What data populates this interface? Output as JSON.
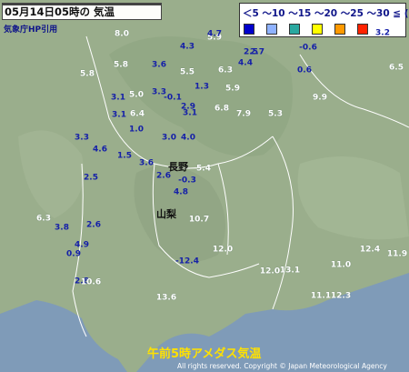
{
  "header": {
    "title": "05月14日05時の 気温",
    "credit": "気象庁HP引用"
  },
  "legend": {
    "scale_text": "＜5 ～10 ～15 ～20 ～25 ～30 ≦ (℃)",
    "colors": [
      "#0000cc",
      "#8fb2ff",
      "#2aa8a0",
      "#ffff00",
      "#ff9900",
      "#ff2200"
    ]
  },
  "cities": {
    "nagano": "長野",
    "yamanashi": "山梨"
  },
  "footer": {
    "caption": "午前5時アメダス気温",
    "copyright": "All rights reserved. Copyright © Japan Meteorological Agency"
  },
  "readings": [
    "4.3",
    "5.9",
    "4.7",
    "2.5",
    "8.0",
    "5.8",
    "-0.6",
    "3.2",
    "3.6",
    "4.4",
    "2.7",
    "0.6",
    "6.3",
    "5.5",
    "5.8",
    "3.3",
    "3.1",
    "5.0",
    "1.3",
    "5.9",
    "9.9",
    "6.5",
    "3.1",
    "-0.1",
    "6.4",
    "2.9",
    "6.8",
    "7.9",
    "5.3",
    "3.1",
    "1.0",
    "4.0",
    "3.3",
    "4.6",
    "3.0",
    "1.5",
    "3.6",
    "2.6",
    "2.5",
    "5.4",
    "-0.3",
    "4.8",
    "10.7",
    "6.3",
    "2.6",
    "3.8",
    "0.9",
    "-12.4",
    "12.0",
    "4.9",
    "2.8",
    "12.0",
    "13.1",
    "10.6",
    "11.0",
    "12.3",
    "11.1",
    "11.9",
    "12.4",
    "13.6"
  ]
}
